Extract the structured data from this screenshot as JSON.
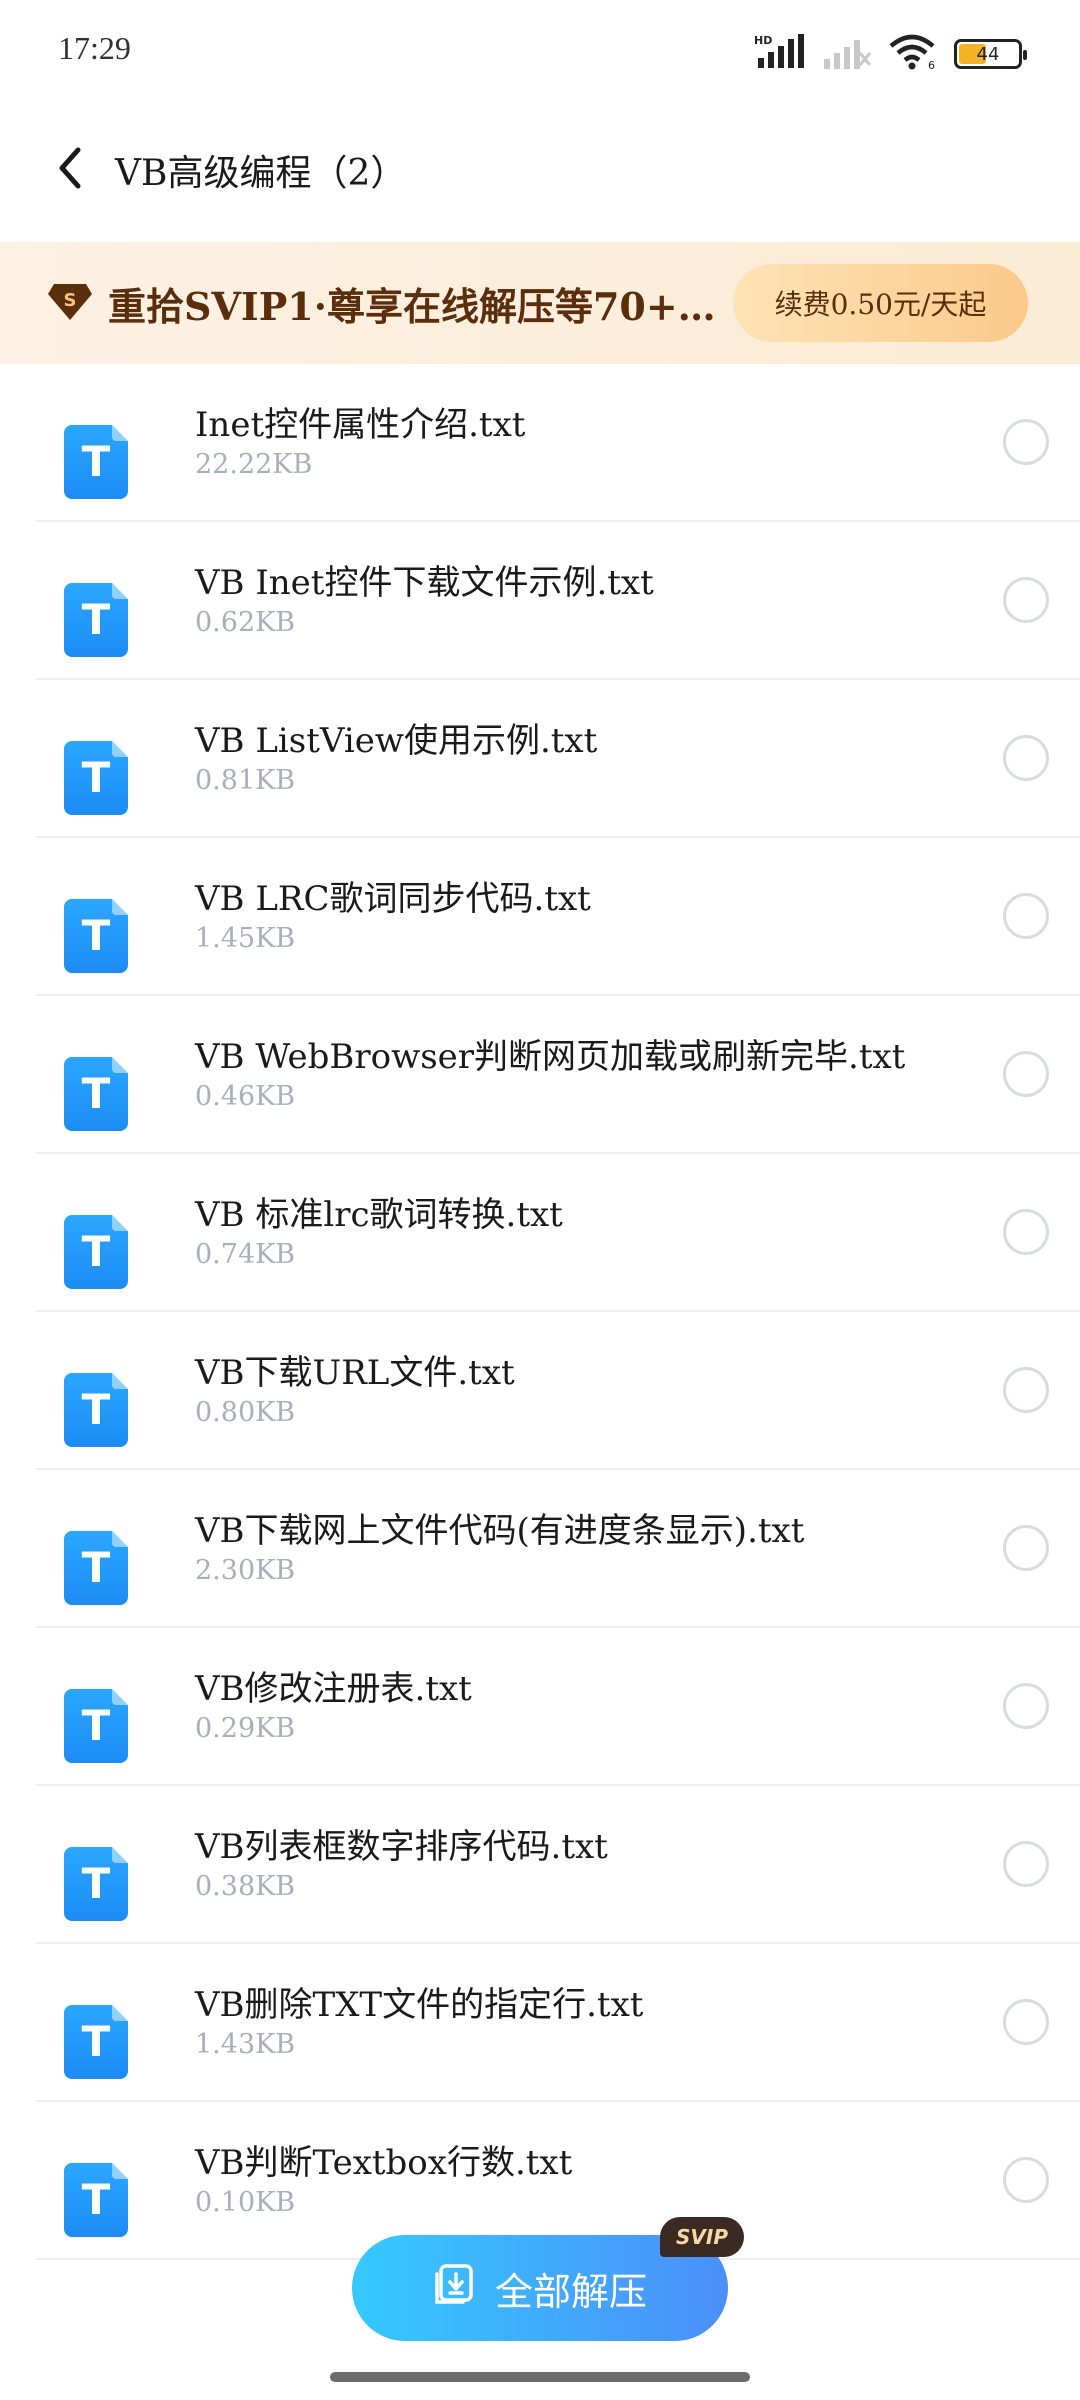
{
  "status_bar": {
    "time": "17:29",
    "battery_level": "44",
    "network_label": "HD",
    "wifi_label": "6"
  },
  "header": {
    "title": "VB高级编程（2）"
  },
  "promo": {
    "text": "重拾SVIP1·尊享在线解压等70+…",
    "button_label": "续费0.50元/天起",
    "accent_color": "#5a2d0c"
  },
  "files": [
    {
      "name": "Inet控件属性介绍.txt",
      "size": "22.22KB"
    },
    {
      "name": "VB Inet控件下载文件示例.txt",
      "size": "0.62KB"
    },
    {
      "name": "VB ListView使用示例.txt",
      "size": "0.81KB"
    },
    {
      "name": "VB LRC歌词同步代码.txt",
      "size": "1.45KB"
    },
    {
      "name": "VB WebBrowser判断网页加载或刷新完毕.txt",
      "size": "0.46KB"
    },
    {
      "name": "VB 标准lrc歌词转换.txt",
      "size": "0.74KB"
    },
    {
      "name": "VB下载URL文件.txt",
      "size": "0.80KB"
    },
    {
      "name": "VB下载网上文件代码(有进度条显示).txt",
      "size": "2.30KB"
    },
    {
      "name": "VB修改注册表.txt",
      "size": "0.29KB"
    },
    {
      "name": "VB列表框数字排序代码.txt",
      "size": "0.38KB"
    },
    {
      "name": "VB删除TXT文件的指定行.txt",
      "size": "1.43KB"
    },
    {
      "name": "VB判断Textbox行数.txt",
      "size": "0.10KB"
    }
  ],
  "file_icon_letter": "T",
  "bottom": {
    "extract_all_label": "全部解压",
    "svip_badge": "SVIP"
  }
}
